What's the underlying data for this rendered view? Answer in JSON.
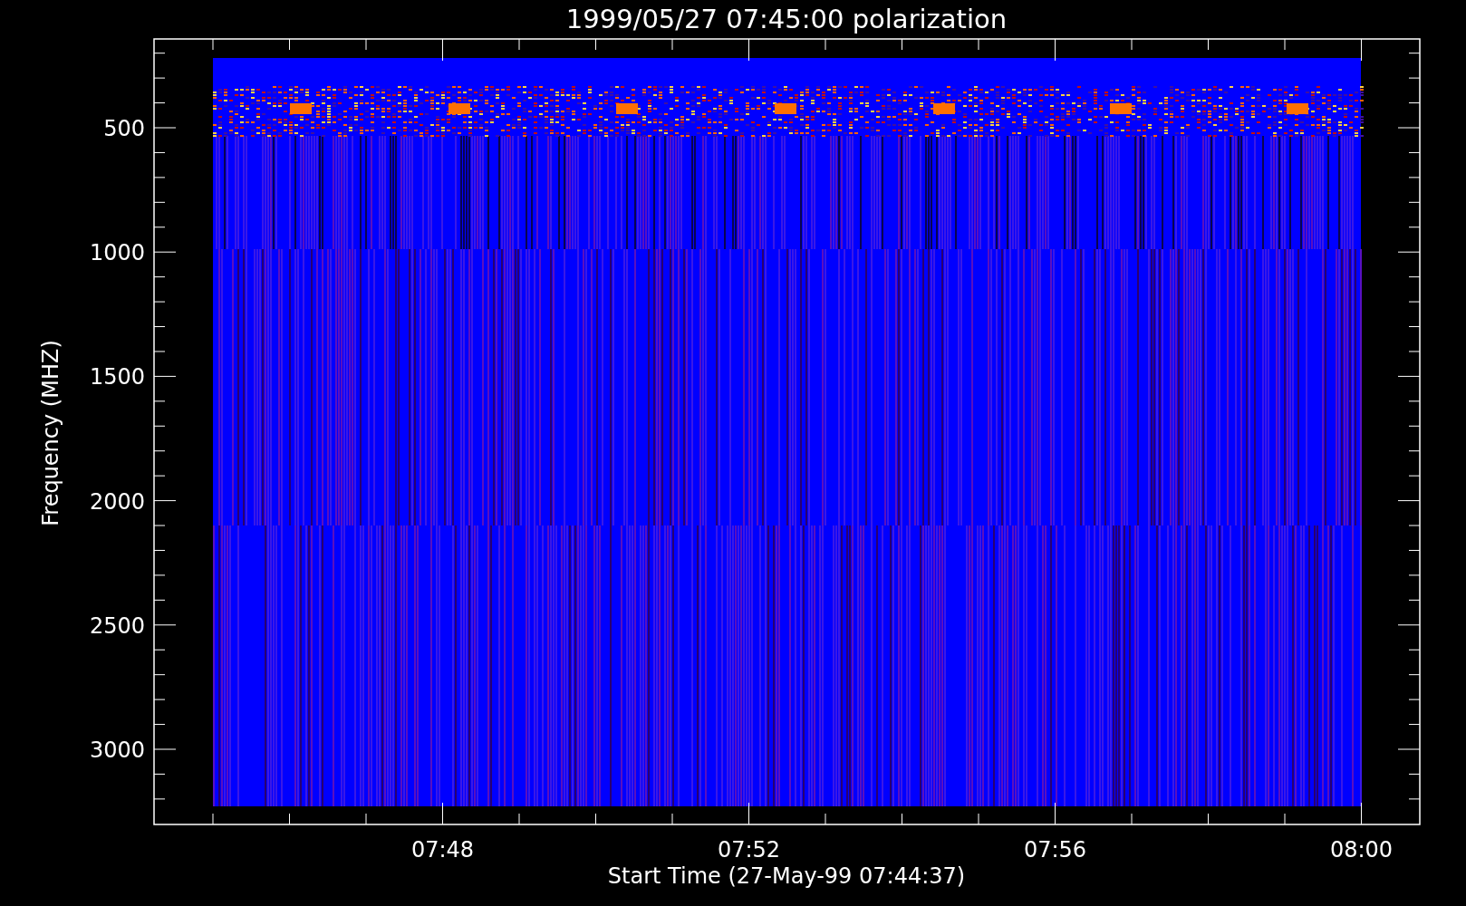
{
  "title": "1999/05/27 07:45:00 polarization",
  "y_axis": {
    "label": "Frequency (MHZ)",
    "ticks": [
      "500",
      "1000",
      "1500",
      "2000",
      "2500",
      "3000"
    ]
  },
  "x_axis": {
    "label": "Start Time (27-May-99 07:44:37)",
    "ticks": [
      "07:48",
      "07:52",
      "07:56",
      "08:00"
    ]
  }
}
